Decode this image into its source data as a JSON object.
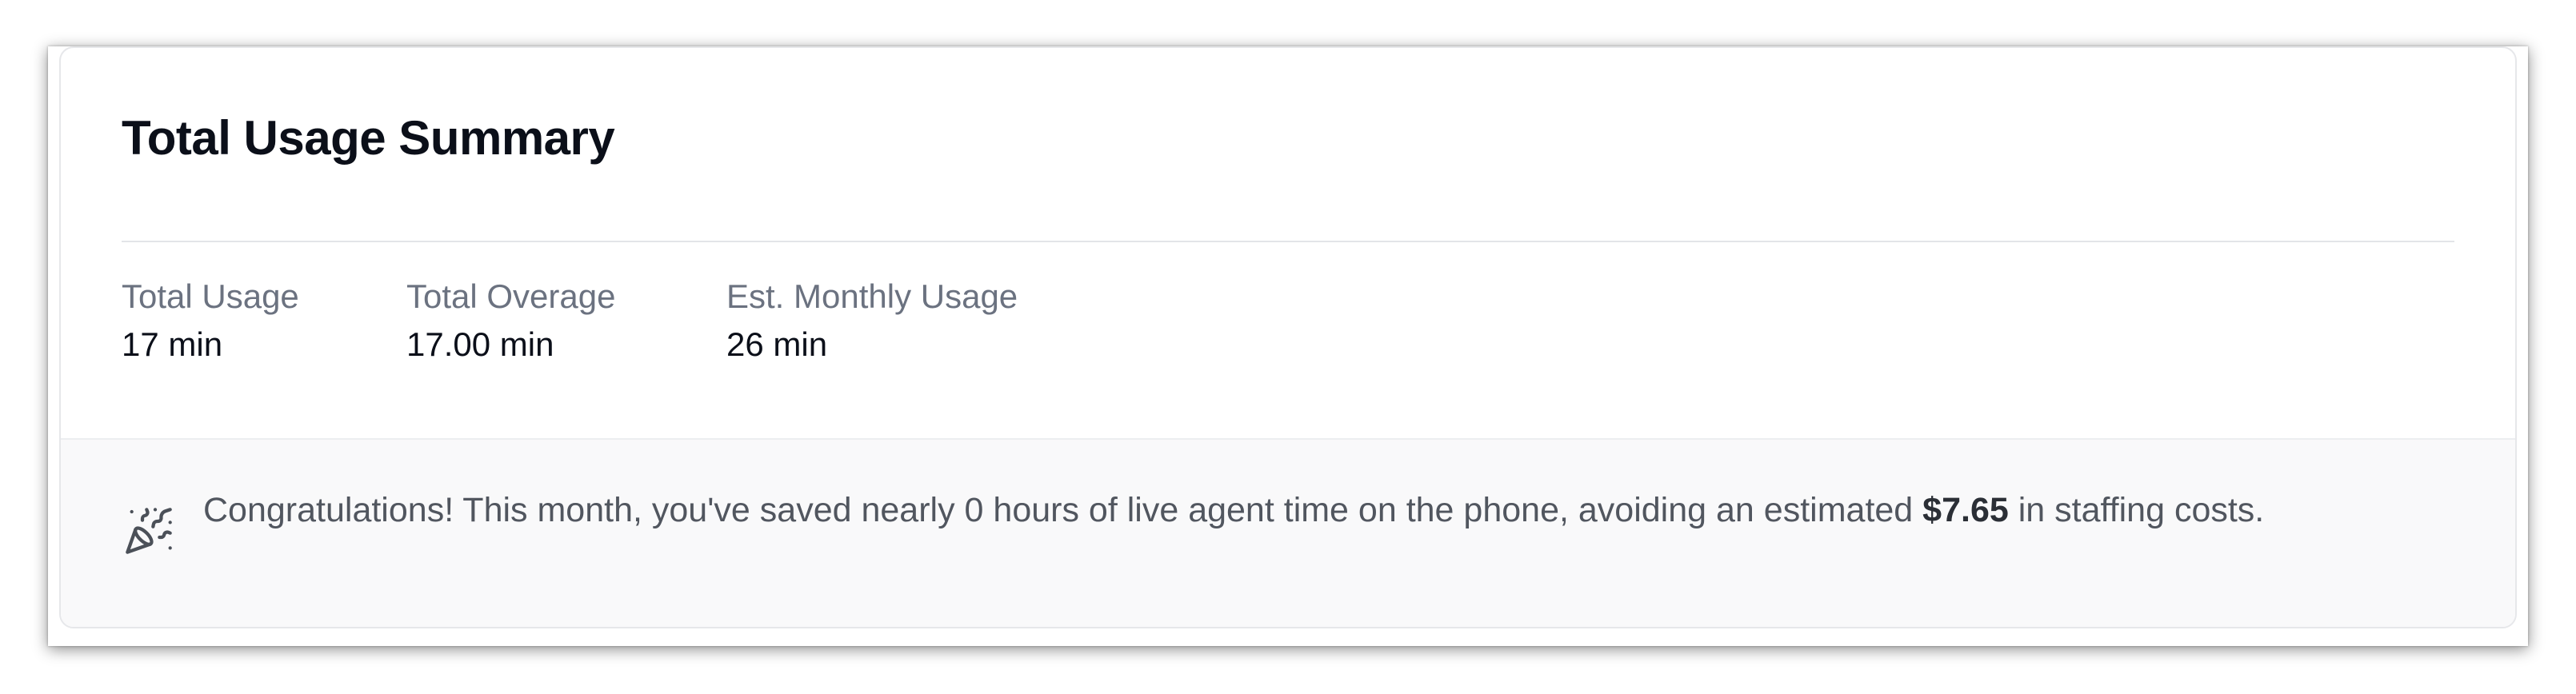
{
  "summary": {
    "title": "Total Usage Summary",
    "stats": [
      {
        "label": "Total Usage",
        "value": "17 min"
      },
      {
        "label": "Total Overage",
        "value": "17.00 min"
      },
      {
        "label": "Est. Monthly Usage",
        "value": "26 min"
      }
    ]
  },
  "footer": {
    "icon": "party-popper-icon",
    "message_before": "Congratulations! This month, you've saved nearly 0 hours of live agent time on the phone, avoiding an estimated ",
    "amount": "$7.65",
    "message_after": " in staffing costs."
  },
  "colors": {
    "title": "#0b0f19",
    "label": "#6b7280",
    "footer_bg": "#f9f9fa"
  }
}
